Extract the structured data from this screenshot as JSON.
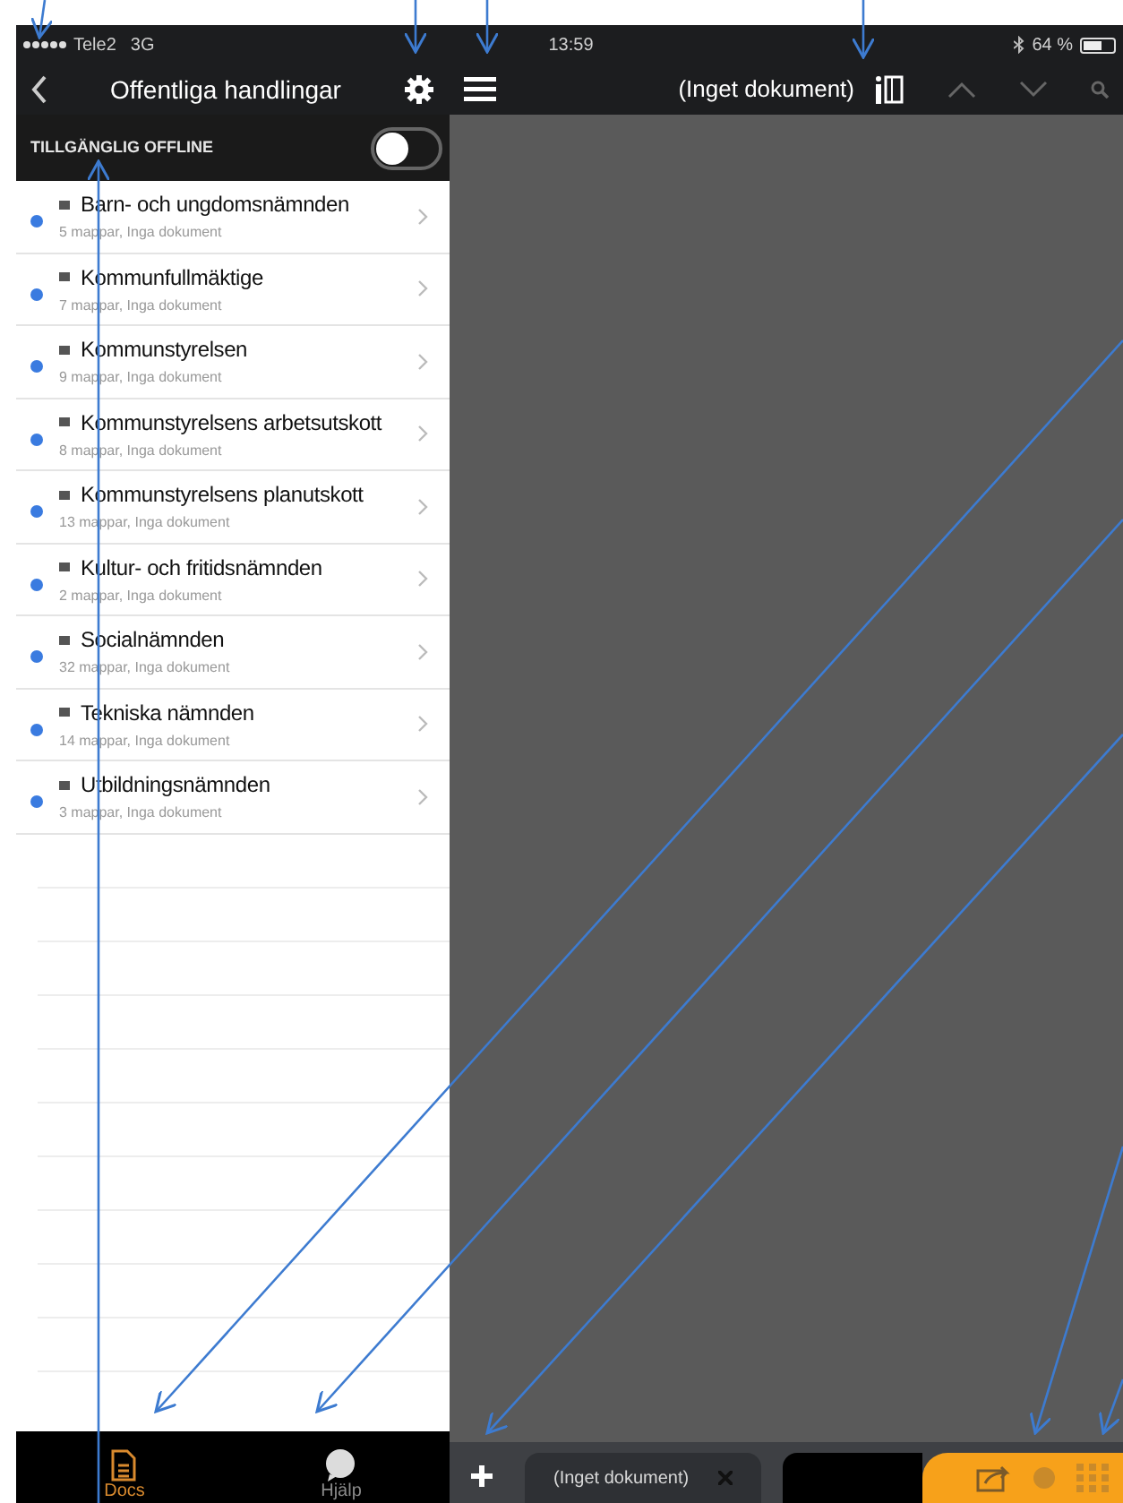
{
  "status_bar": {
    "carrier": "Tele2",
    "network": "3G",
    "time": "13:59",
    "battery": "64 %"
  },
  "sidebar": {
    "title": "Offentliga handlingar",
    "offline": {
      "label": "TILLGÄNGLIG OFFLINE",
      "on": false
    },
    "items": [
      {
        "title": "Barn- och ungdomsnämnden",
        "subtitle": "5 mappar, Inga dokument"
      },
      {
        "title": "Kommunfullmäktige",
        "subtitle": "7 mappar, Inga dokument"
      },
      {
        "title": "Kommunstyrelsen",
        "subtitle": "9 mappar, Inga dokument"
      },
      {
        "title": "Kommunstyrelsens arbetsutskott",
        "subtitle": "8 mappar, Inga dokument"
      },
      {
        "title": "Kommunstyrelsens planutskott",
        "subtitle": "13 mappar, Inga dokument"
      },
      {
        "title": "Kultur- och fritidsnämnden",
        "subtitle": "2 mappar, Inga dokument"
      },
      {
        "title": "Socialnämnden",
        "subtitle": "32 mappar, Inga dokument"
      },
      {
        "title": "Tekniska nämnden",
        "subtitle": "14 mappar, Inga dokument"
      },
      {
        "title": "Utbildningsnämnden",
        "subtitle": "3 mappar, Inga dokument"
      }
    ],
    "tabs": [
      {
        "label": "Docs",
        "selected": true
      },
      {
        "label": "Hjälp",
        "selected": false
      }
    ]
  },
  "document": {
    "title": "(Inget dokument)",
    "tab": "(Inget dokument)"
  }
}
